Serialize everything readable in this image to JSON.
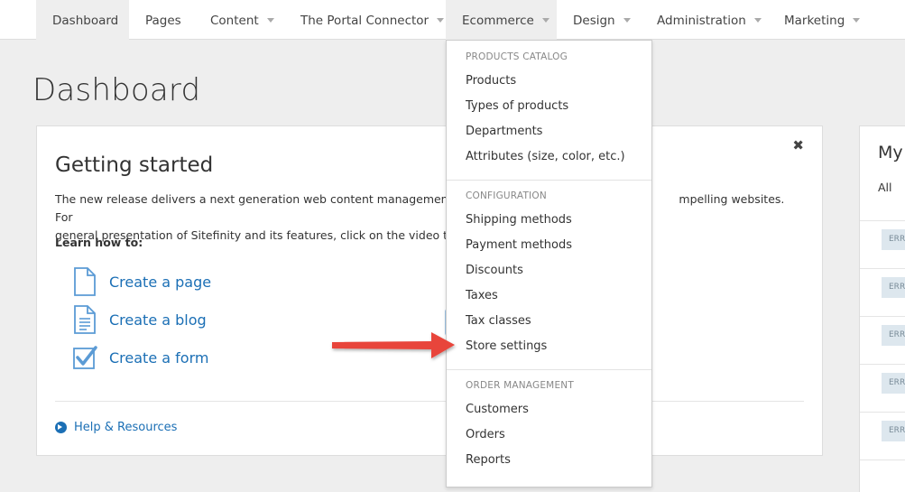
{
  "nav": {
    "items": [
      {
        "label": "Dashboard"
      },
      {
        "label": "Pages"
      },
      {
        "label": "Content"
      },
      {
        "label": "The Portal Connector"
      },
      {
        "label": "Ecommerce"
      },
      {
        "label": "Design"
      },
      {
        "label": "Administration"
      },
      {
        "label": "Marketing"
      }
    ]
  },
  "page": {
    "title": "Dashboard"
  },
  "getting_started": {
    "title": "Getting started",
    "desc_line1": "The new release delivers a next generation web content management sy",
    "desc_line1_tail": "mpelling websites. For",
    "desc_line2": "general presentation of Sitefinity and its features, click on the video to th",
    "learn": "Learn how to:",
    "links": [
      {
        "label": "Create a page",
        "icon": "page-icon"
      },
      {
        "label": "Create a blog",
        "icon": "blog-icon"
      },
      {
        "label": "Create a form",
        "icon": "form-icon"
      }
    ],
    "help": "Help & Resources"
  },
  "my_panel": {
    "title": "My",
    "filter": "All",
    "badge": "ERRO",
    "rows": 5
  },
  "dropdown": {
    "sections": [
      {
        "header": "PRODUCTS CATALOG",
        "items": [
          "Products",
          "Types of products",
          "Departments",
          "Attributes (size, color, etc.)"
        ]
      },
      {
        "header": "CONFIGURATION",
        "items": [
          "Shipping methods",
          "Payment methods",
          "Discounts",
          "Taxes",
          "Tax classes",
          "Store settings"
        ]
      },
      {
        "header": "ORDER MANAGEMENT",
        "items": [
          "Customers",
          "Orders",
          "Reports"
        ]
      }
    ]
  },
  "colors": {
    "link": "#1b6fb5",
    "arrow": "#e8443a",
    "icon": "#5b9bd5"
  }
}
